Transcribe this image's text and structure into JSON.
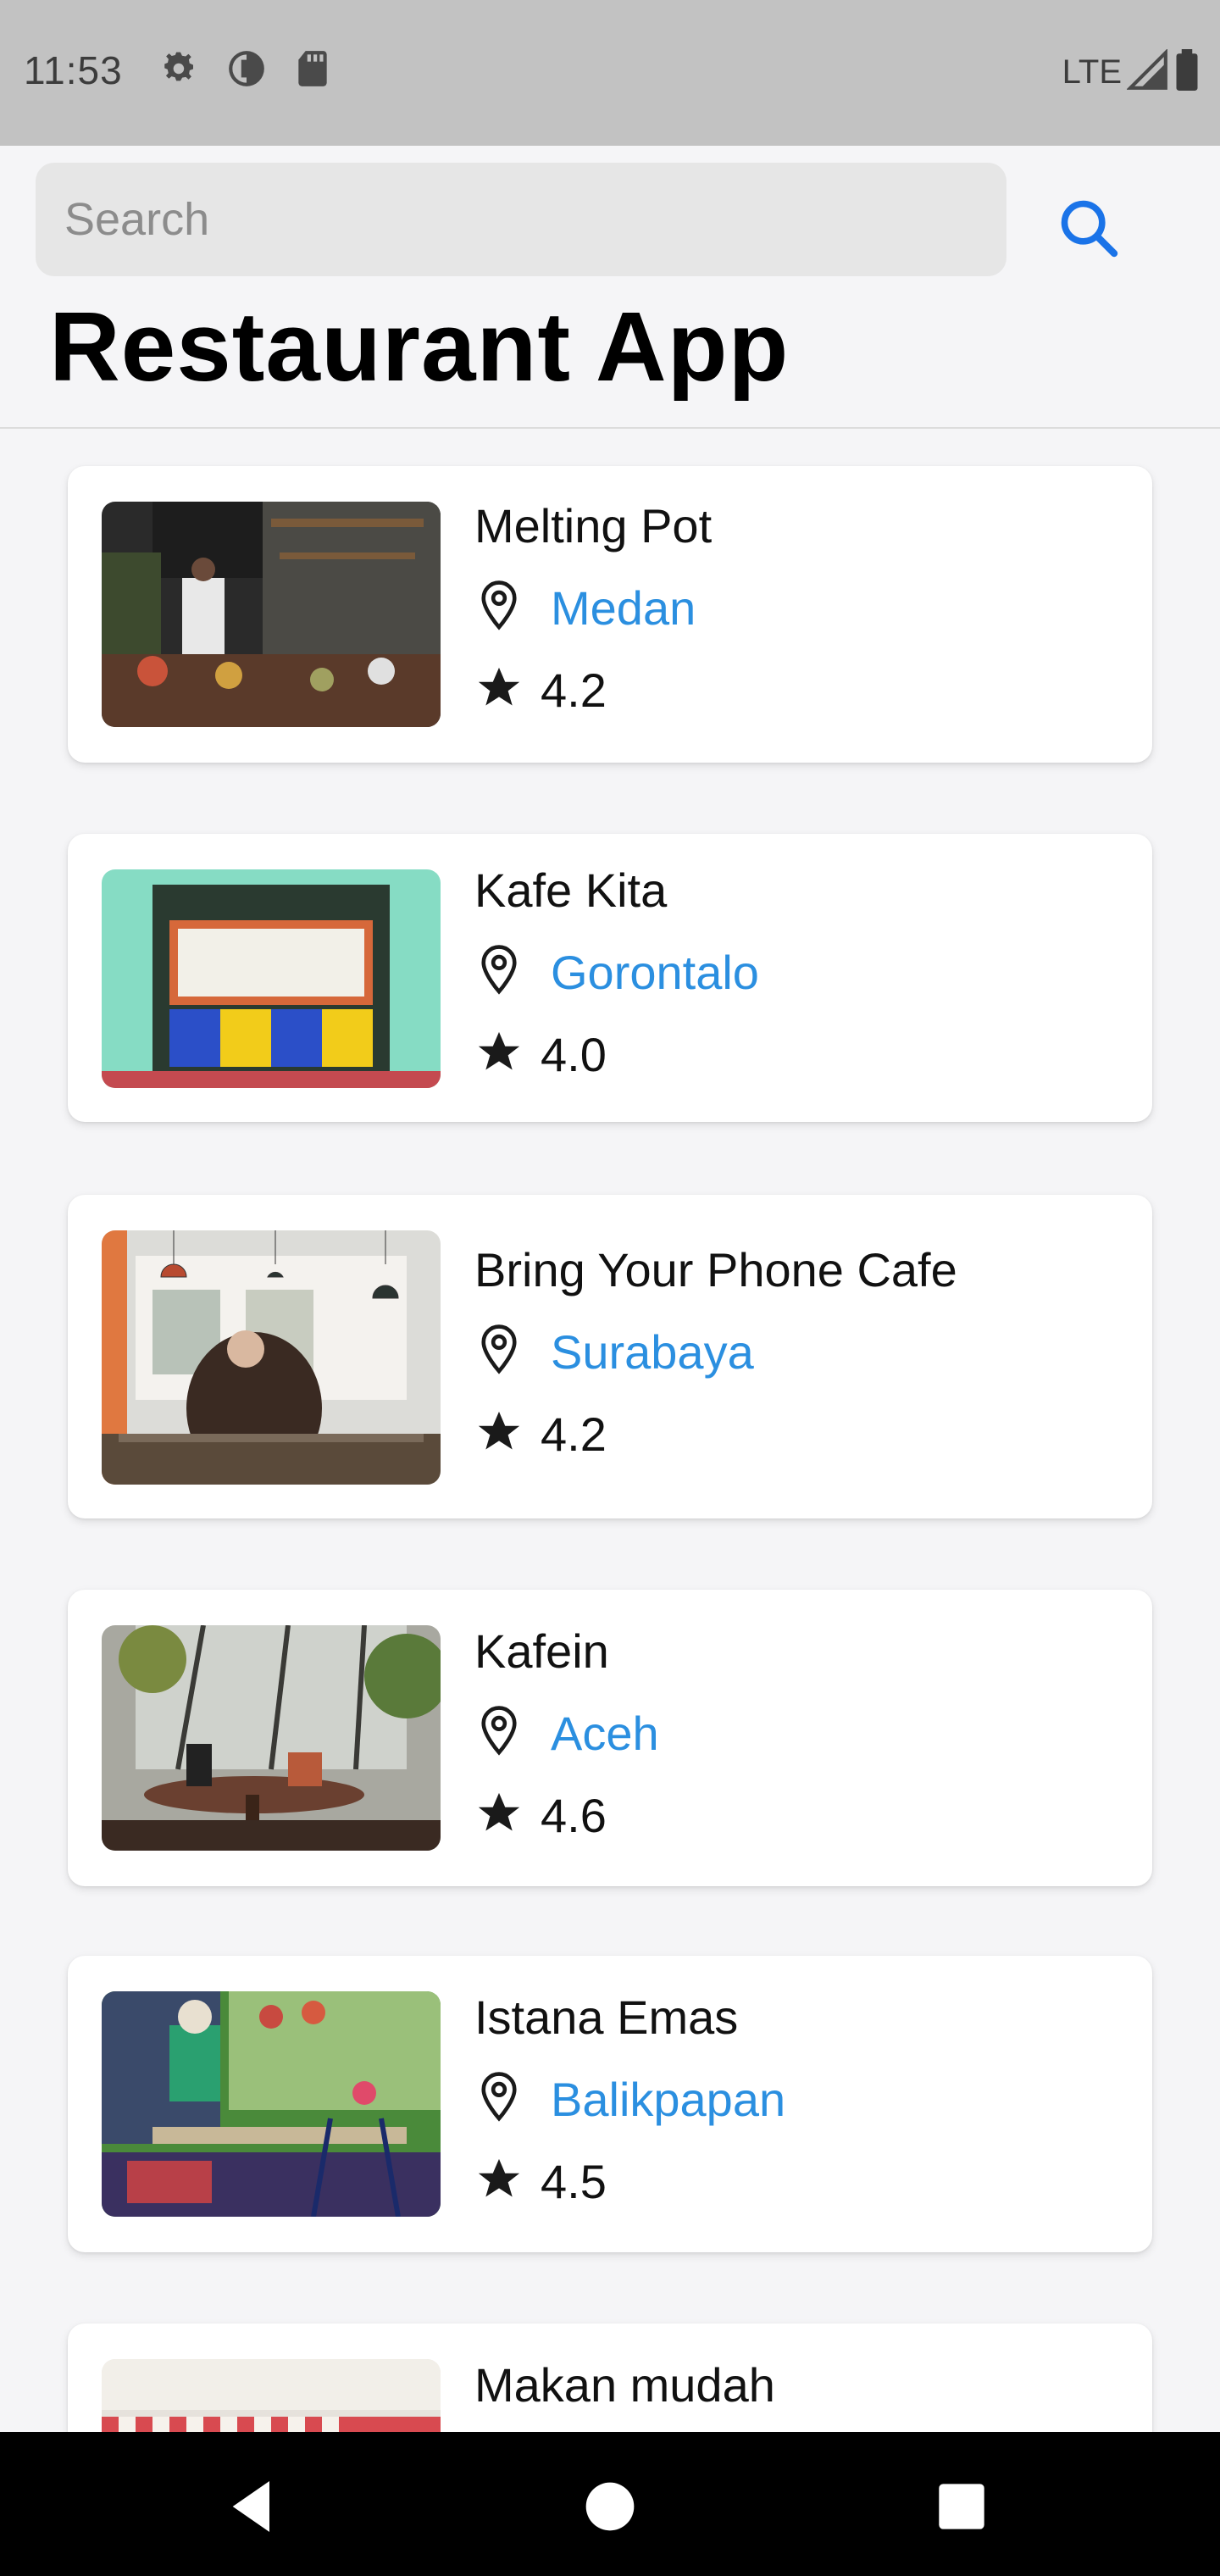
{
  "status_bar": {
    "time": "11:53",
    "network_label": "LTE",
    "icons": [
      "settings-gear-icon",
      "vpn-shield-icon",
      "sd-card-icon",
      "signal-icon",
      "battery-icon"
    ]
  },
  "header": {
    "search_placeholder": "Search",
    "search_icon": "search-icon",
    "title": "Restaurant App"
  },
  "colors": {
    "accent": "#2b8fe0",
    "search_icon": "#1a73e8",
    "status_bar_bg": "#c2c2c2",
    "page_bg": "#f5f5f7",
    "card_bg": "#ffffff",
    "nav_bar_bg": "#000000"
  },
  "restaurants": [
    {
      "name": "Melting Pot",
      "city": "Medan",
      "rating": "4.2"
    },
    {
      "name": "Kafe Kita",
      "city": "Gorontalo",
      "rating": "4.0"
    },
    {
      "name": "Bring Your Phone Cafe",
      "city": "Surabaya",
      "rating": "4.2"
    },
    {
      "name": "Kafein",
      "city": "Aceh",
      "rating": "4.6"
    },
    {
      "name": "Istana Emas",
      "city": "Balikpapan",
      "rating": "4.5"
    },
    {
      "name": "Makan mudah"
    }
  ],
  "nav_bar": {
    "buttons": [
      "back-icon",
      "home-icon",
      "recents-icon"
    ]
  }
}
